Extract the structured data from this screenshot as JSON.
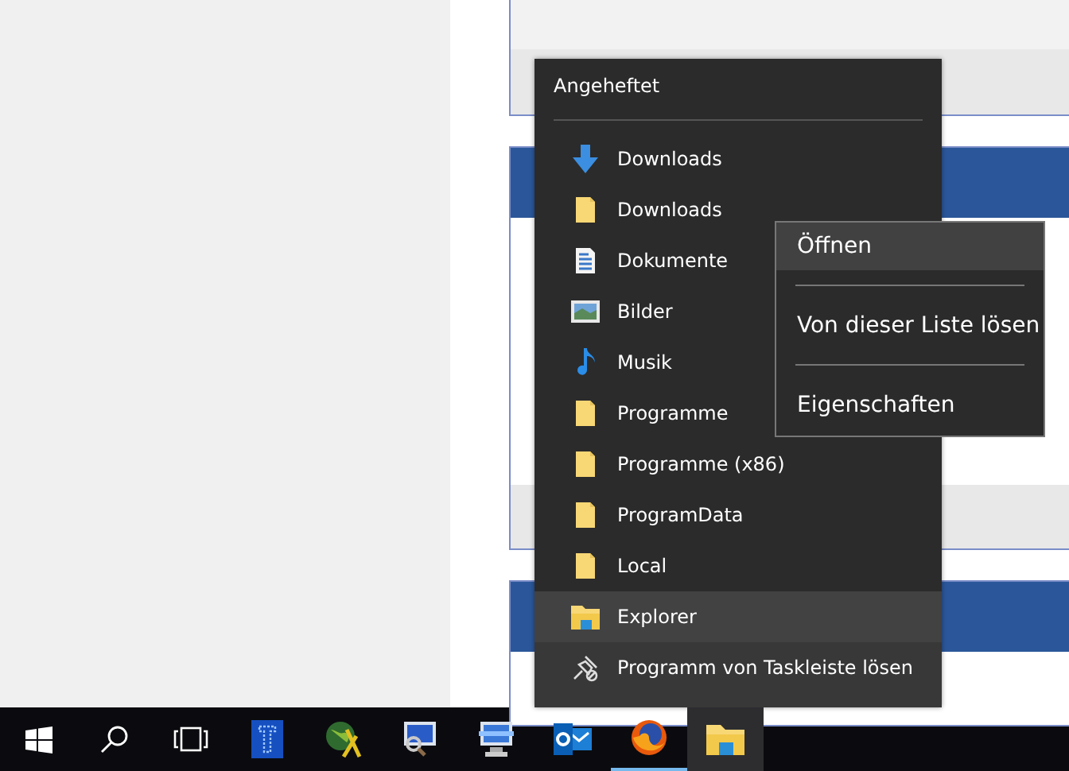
{
  "jump_list": {
    "header": "Angeheftet",
    "pinned": [
      {
        "label": "Downloads",
        "kind": "download"
      },
      {
        "label": "Downloads",
        "kind": "folder"
      },
      {
        "label": "Dokumente",
        "kind": "document"
      },
      {
        "label": "Bilder",
        "kind": "pictures"
      },
      {
        "label": "Musik",
        "kind": "music"
      },
      {
        "label": "Programme",
        "kind": "folder"
      },
      {
        "label": "Programme (x86)",
        "kind": "folder"
      },
      {
        "label": "ProgramData",
        "kind": "folder"
      },
      {
        "label": "Local",
        "kind": "folder"
      }
    ],
    "tasks": [
      {
        "label": "Explorer",
        "kind": "explorer"
      },
      {
        "label": "Programm von Taskleiste lösen",
        "kind": "unpin"
      }
    ]
  },
  "context_menu": [
    {
      "label": "Öffnen",
      "selected": true
    },
    {
      "label": "Von dieser Liste lösen",
      "selected": false
    },
    {
      "label": "Eigenschaften",
      "selected": false
    }
  ],
  "taskbar": [
    {
      "kind": "start",
      "running": false,
      "selected": false
    },
    {
      "kind": "search",
      "running": false,
      "selected": false
    },
    {
      "kind": "taskview",
      "running": false,
      "selected": false
    },
    {
      "kind": "tool",
      "running": false,
      "selected": false
    },
    {
      "kind": "globe",
      "running": false,
      "selected": false
    },
    {
      "kind": "monitor",
      "running": false,
      "selected": false
    },
    {
      "kind": "network",
      "running": false,
      "selected": false
    },
    {
      "kind": "mail",
      "running": false,
      "selected": false
    },
    {
      "kind": "browser",
      "running": true,
      "selected": false
    },
    {
      "kind": "explorer",
      "running": false,
      "selected": true
    }
  ]
}
